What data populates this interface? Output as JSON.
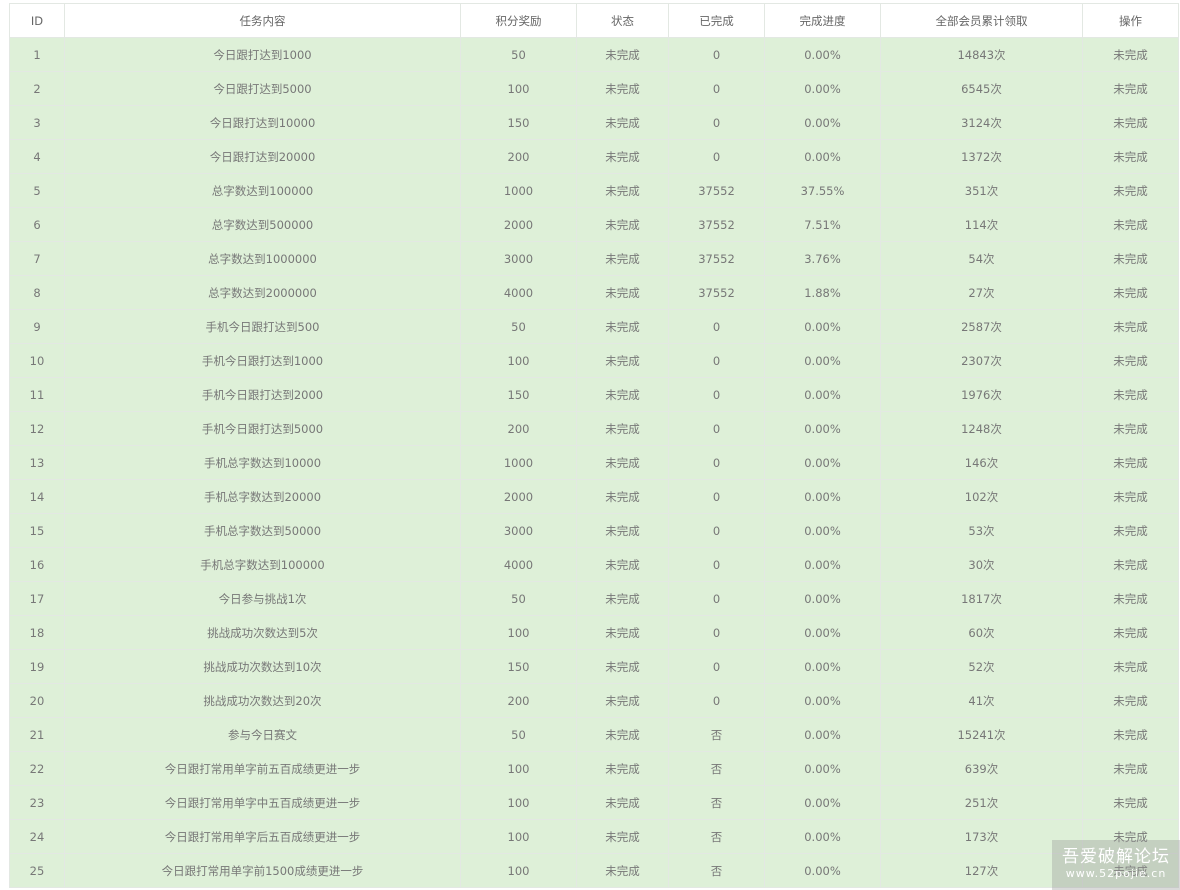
{
  "table": {
    "headers": [
      "ID",
      "任务内容",
      "积分奖励",
      "状态",
      "已完成",
      "完成进度",
      "全部会员累计领取",
      "操作"
    ],
    "rows": [
      [
        "1",
        "今日跟打达到1000",
        "50",
        "未完成",
        "0",
        "0.00%",
        "14843次",
        "未完成"
      ],
      [
        "2",
        "今日跟打达到5000",
        "100",
        "未完成",
        "0",
        "0.00%",
        "6545次",
        "未完成"
      ],
      [
        "3",
        "今日跟打达到10000",
        "150",
        "未完成",
        "0",
        "0.00%",
        "3124次",
        "未完成"
      ],
      [
        "4",
        "今日跟打达到20000",
        "200",
        "未完成",
        "0",
        "0.00%",
        "1372次",
        "未完成"
      ],
      [
        "5",
        "总字数达到100000",
        "1000",
        "未完成",
        "37552",
        "37.55%",
        "351次",
        "未完成"
      ],
      [
        "6",
        "总字数达到500000",
        "2000",
        "未完成",
        "37552",
        "7.51%",
        "114次",
        "未完成"
      ],
      [
        "7",
        "总字数达到1000000",
        "3000",
        "未完成",
        "37552",
        "3.76%",
        "54次",
        "未完成"
      ],
      [
        "8",
        "总字数达到2000000",
        "4000",
        "未完成",
        "37552",
        "1.88%",
        "27次",
        "未完成"
      ],
      [
        "9",
        "手机今日跟打达到500",
        "50",
        "未完成",
        "0",
        "0.00%",
        "2587次",
        "未完成"
      ],
      [
        "10",
        "手机今日跟打达到1000",
        "100",
        "未完成",
        "0",
        "0.00%",
        "2307次",
        "未完成"
      ],
      [
        "11",
        "手机今日跟打达到2000",
        "150",
        "未完成",
        "0",
        "0.00%",
        "1976次",
        "未完成"
      ],
      [
        "12",
        "手机今日跟打达到5000",
        "200",
        "未完成",
        "0",
        "0.00%",
        "1248次",
        "未完成"
      ],
      [
        "13",
        "手机总字数达到10000",
        "1000",
        "未完成",
        "0",
        "0.00%",
        "146次",
        "未完成"
      ],
      [
        "14",
        "手机总字数达到20000",
        "2000",
        "未完成",
        "0",
        "0.00%",
        "102次",
        "未完成"
      ],
      [
        "15",
        "手机总字数达到50000",
        "3000",
        "未完成",
        "0",
        "0.00%",
        "53次",
        "未完成"
      ],
      [
        "16",
        "手机总字数达到100000",
        "4000",
        "未完成",
        "0",
        "0.00%",
        "30次",
        "未完成"
      ],
      [
        "17",
        "今日参与挑战1次",
        "50",
        "未完成",
        "0",
        "0.00%",
        "1817次",
        "未完成"
      ],
      [
        "18",
        "挑战成功次数达到5次",
        "100",
        "未完成",
        "0",
        "0.00%",
        "60次",
        "未完成"
      ],
      [
        "19",
        "挑战成功次数达到10次",
        "150",
        "未完成",
        "0",
        "0.00%",
        "52次",
        "未完成"
      ],
      [
        "20",
        "挑战成功次数达到20次",
        "200",
        "未完成",
        "0",
        "0.00%",
        "41次",
        "未完成"
      ],
      [
        "21",
        "参与今日赛文",
        "50",
        "未完成",
        "否",
        "0.00%",
        "15241次",
        "未完成"
      ],
      [
        "22",
        "今日跟打常用单字前五百成绩更进一步",
        "100",
        "未完成",
        "否",
        "0.00%",
        "639次",
        "未完成"
      ],
      [
        "23",
        "今日跟打常用单字中五百成绩更进一步",
        "100",
        "未完成",
        "否",
        "0.00%",
        "251次",
        "未完成"
      ],
      [
        "24",
        "今日跟打常用单字后五百成绩更进一步",
        "100",
        "未完成",
        "否",
        "0.00%",
        "173次",
        "未完成"
      ],
      [
        "25",
        "今日跟打常用单字前1500成绩更进一步",
        "100",
        "未完成",
        "否",
        "0.00%",
        "127次",
        "未完成"
      ]
    ]
  },
  "watermark": {
    "name": "吾爱破解论坛",
    "url": "www.52pojie.cn"
  },
  "colors": {
    "row_background": "#def0d8",
    "header_background": "#ffffff",
    "border": "#e3e8e3",
    "text": "#777777"
  }
}
